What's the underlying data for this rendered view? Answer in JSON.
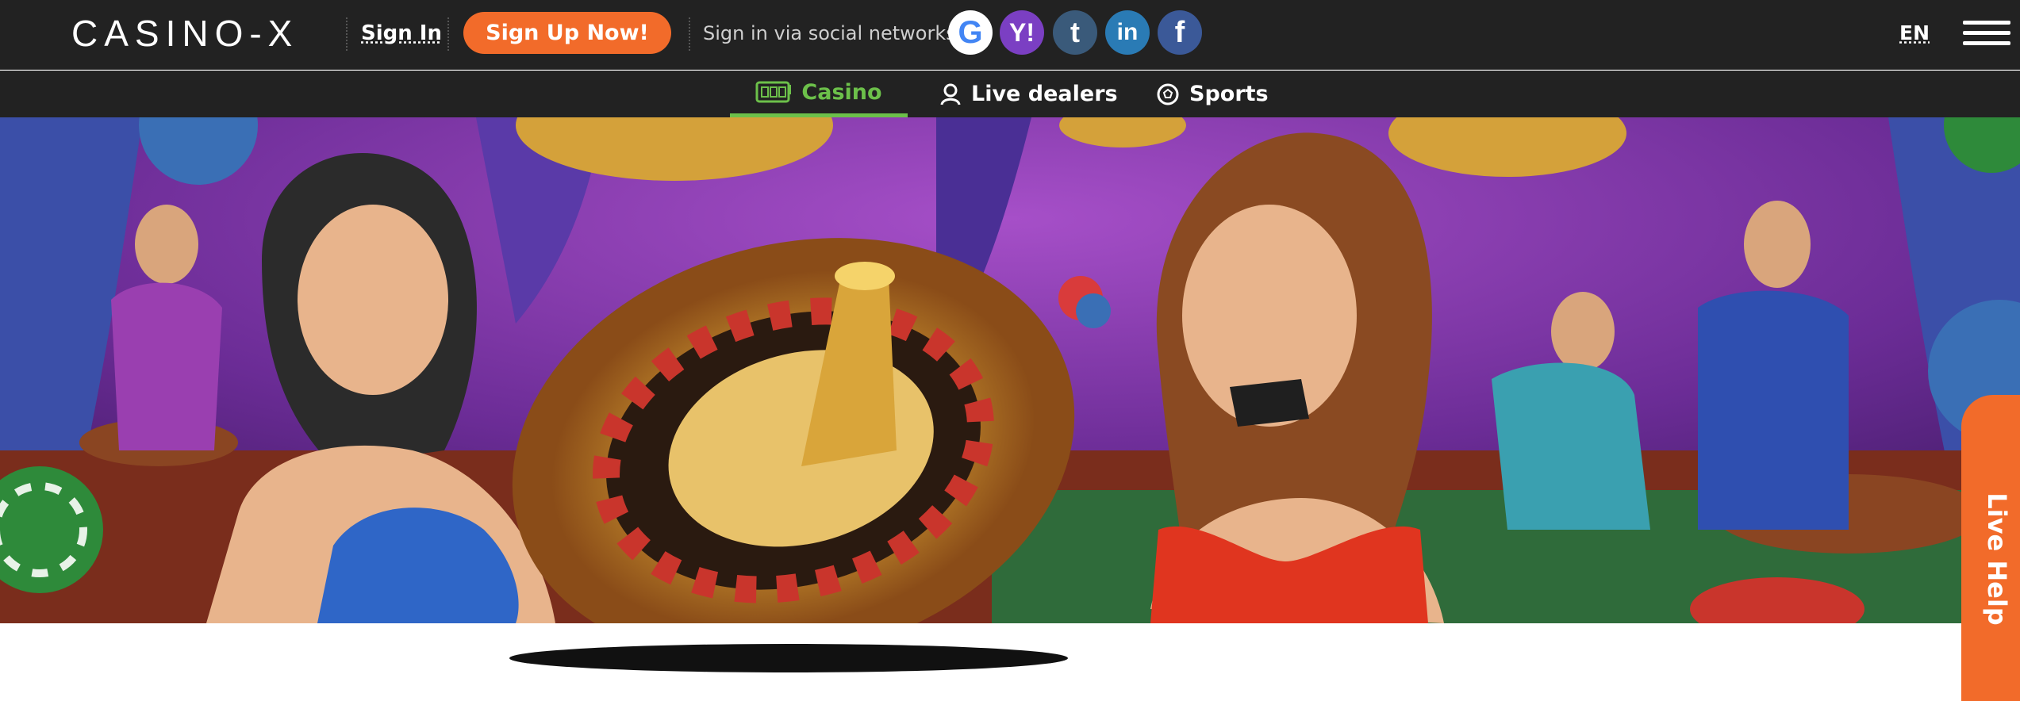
{
  "header": {
    "logo_text": "CASINO-X",
    "signin_label": "Sign In",
    "signup_label": "Sign Up Now!",
    "social_label": "Sign in via social networks:",
    "social": {
      "google": "G",
      "yahoo": "Y!",
      "tumblr": "t",
      "linkedin": "in",
      "facebook": "f"
    },
    "language": "EN"
  },
  "nav": {
    "casino": "Casino",
    "live_dealers": "Live dealers",
    "sports": "Sports"
  },
  "live_help": "Live Help",
  "colors": {
    "topbar": "#222222",
    "accent_orange": "#f26b2a",
    "accent_green": "#6cc04a"
  }
}
